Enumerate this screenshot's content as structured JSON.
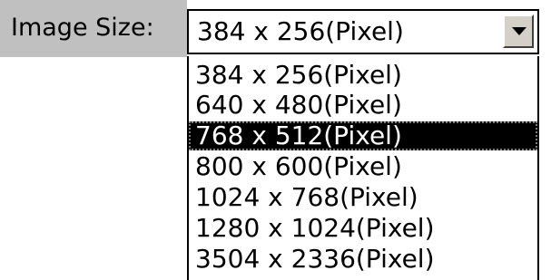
{
  "image_size": {
    "label": "Image Size:",
    "selected_value": "384 x 256(Pixel)",
    "dropdown_icon": "chevron-down-icon",
    "highlighted_option": "768 x 512(Pixel)",
    "options": [
      {
        "label": "384 x 256(Pixel)"
      },
      {
        "label": "640 x 480(Pixel)"
      },
      {
        "label": "768 x 512(Pixel)"
      },
      {
        "label": "800 x 600(Pixel)"
      },
      {
        "label": "1024 x 768(Pixel)"
      },
      {
        "label": "1280 x 1024(Pixel)"
      },
      {
        "label": "3504 x 2336(Pixel)"
      }
    ]
  }
}
